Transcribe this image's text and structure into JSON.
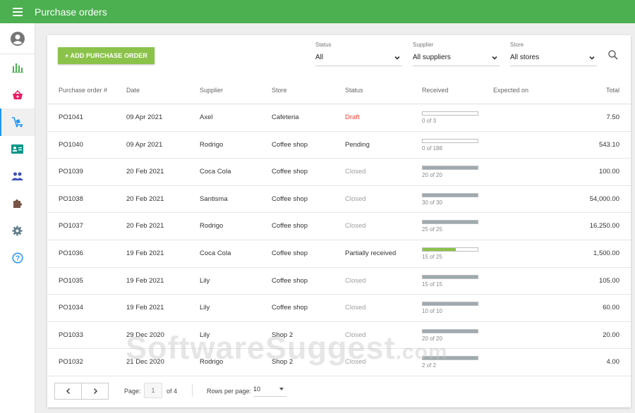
{
  "header": {
    "title": "Purchase orders"
  },
  "toolbar": {
    "add_label": "+ ADD PURCHASE ORDER"
  },
  "filters": {
    "status": {
      "label": "Status",
      "value": "All"
    },
    "supplier": {
      "label": "Supplier",
      "value": "All suppliers"
    },
    "store": {
      "label": "Store",
      "value": "All stores"
    }
  },
  "table": {
    "columns": [
      "Purchase order #",
      "Date",
      "Supplier",
      "Store",
      "Status",
      "Received",
      "Expected on",
      "Total"
    ],
    "rows": [
      {
        "po": "PO1041",
        "date": "09 Apr 2021",
        "supplier": "Axel",
        "store": "Cafeteria",
        "status": "Draft",
        "received": "0 of 3",
        "received_fraction": 0,
        "expected": "",
        "total": "7.50"
      },
      {
        "po": "PO1040",
        "date": "09 Apr 2021",
        "supplier": "Rodrigo",
        "store": "Coffee shop",
        "status": "Pending",
        "received": "0 of 188",
        "received_fraction": 0,
        "expected": "",
        "total": "543.10"
      },
      {
        "po": "PO1039",
        "date": "20 Feb 2021",
        "supplier": "Coca Cola",
        "store": "Coffee shop",
        "status": "Closed",
        "received": "20 of 20",
        "received_fraction": 1,
        "expected": "",
        "total": "100.00"
      },
      {
        "po": "PO1038",
        "date": "20 Feb 2021",
        "supplier": "Santisma",
        "store": "Coffee shop",
        "status": "Closed",
        "received": "30 of 30",
        "received_fraction": 1,
        "expected": "",
        "total": "54,000.00"
      },
      {
        "po": "PO1037",
        "date": "20 Feb 2021",
        "supplier": "Rodrigo",
        "store": "Coffee shop",
        "status": "Closed",
        "received": "25 of 25",
        "received_fraction": 1,
        "expected": "",
        "total": "16,250.00"
      },
      {
        "po": "PO1036",
        "date": "19 Feb 2021",
        "supplier": "Coca Cola",
        "store": "Coffee shop",
        "status": "Partially received",
        "received": "15 of 25",
        "received_fraction": 0.6,
        "expected": "",
        "total": "1,500.00"
      },
      {
        "po": "PO1035",
        "date": "19 Feb 2021",
        "supplier": "Lily",
        "store": "Coffee shop",
        "status": "Closed",
        "received": "15 of 15",
        "received_fraction": 1,
        "expected": "",
        "total": "105.00"
      },
      {
        "po": "PO1034",
        "date": "19 Feb 2021",
        "supplier": "Lily",
        "store": "Coffee shop",
        "status": "Closed",
        "received": "10 of 10",
        "received_fraction": 1,
        "expected": "",
        "total": "60.00"
      },
      {
        "po": "PO1033",
        "date": "29 Dec 2020",
        "supplier": "Lily",
        "store": "Shop 2",
        "status": "Closed",
        "received": "20 of 20",
        "received_fraction": 1,
        "expected": "",
        "total": "20.00"
      },
      {
        "po": "PO1032",
        "date": "21 Dec 2020",
        "supplier": "Rodrigo",
        "store": "Shop 2",
        "status": "Closed",
        "received": "2 of 2",
        "received_fraction": 1,
        "expected": "",
        "total": "4.00"
      }
    ]
  },
  "footer": {
    "page_label": "Page:",
    "page_value": "1",
    "page_of": "of 4",
    "rows_label": "Rows per page:",
    "rows_value": "10"
  },
  "watermark": {
    "main": "SoftwareSuggest",
    "suffix": ".com"
  },
  "colors": {
    "topbar": "#4caf50",
    "add_button": "#8bc34a",
    "draft": "#f44336",
    "closed": "#9e9e9e",
    "active_nav": "#2196f3"
  },
  "icons": {
    "sidebar": [
      "account-icon",
      "reports-icon",
      "basket-icon",
      "inventory-icon",
      "employee-card-icon",
      "customers-icon",
      "integrations-icon",
      "settings-icon",
      "help-icon"
    ],
    "search": "search-icon"
  }
}
